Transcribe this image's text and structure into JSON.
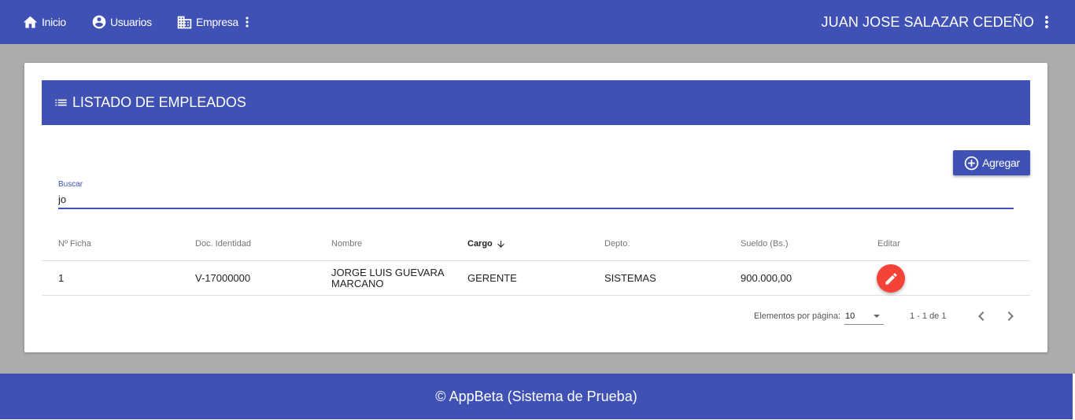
{
  "nav": {
    "items": [
      {
        "label": "Inicio",
        "icon": "home-icon"
      },
      {
        "label": "Usuarios",
        "icon": "account-circle-icon"
      },
      {
        "label": "Empresa",
        "icon": "business-icon"
      }
    ],
    "user_name": "JUAN JOSE SALAZAR CEDEÑO"
  },
  "card": {
    "title": "LISTADO DE EMPLEADOS",
    "add_label": "Agregar"
  },
  "search": {
    "label": "Buscar",
    "value": "jo"
  },
  "table": {
    "headers": [
      "Nº Ficha",
      "Doc. Identidad",
      "Nombre",
      "Cargo",
      "Depto.",
      "Sueldo (Bs.)",
      "Editar"
    ],
    "sorted_column": "Cargo",
    "sort_direction": "desc",
    "rows": [
      {
        "ficha": "1",
        "doc": "V-17000000",
        "nombre": "JORGE LUIS GUEVARA MARCANO",
        "cargo": "GERENTE",
        "depto": "SISTEMAS",
        "sueldo": "900.000,00"
      }
    ]
  },
  "paginator": {
    "items_per_page_label": "Elementos por página:",
    "page_size": "10",
    "range": "1 - 1 de 1"
  },
  "footer": {
    "text": "© AppBeta (Sistema de Prueba)"
  },
  "colors": {
    "primary": "#3f51b5",
    "accent": "#f44336",
    "background": "#acacac"
  }
}
